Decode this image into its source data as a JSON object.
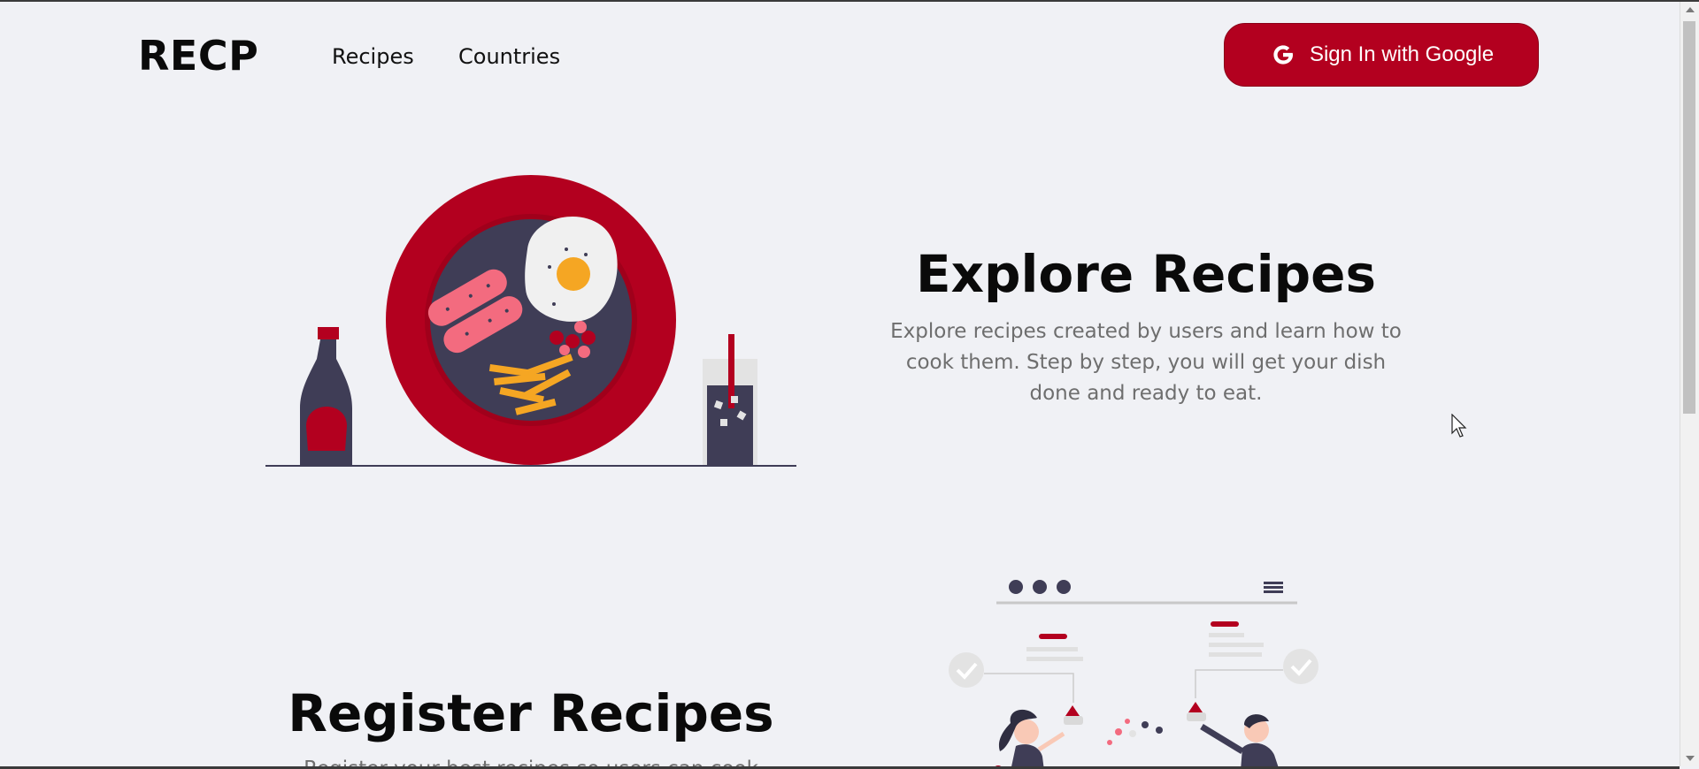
{
  "header": {
    "logo": "RECP",
    "nav": [
      {
        "label": "Recipes"
      },
      {
        "label": "Countries"
      }
    ],
    "signin": {
      "label": "Sign In with Google",
      "icon": "google-icon"
    }
  },
  "hero": {
    "title": "Explore Recipes",
    "description": "Explore recipes created by users and learn how to cook them. Step by step, you will get your dish done and ready to eat.",
    "illustration": "breakfast-plate-illustration"
  },
  "register": {
    "title": "Register Recipes",
    "description": "Register your best recipes so users can cook",
    "illustration": "people-sharing-illustration"
  },
  "colors": {
    "accent": "#b3001f",
    "background": "#f0f1f5",
    "text": "#0a0a0a",
    "muted_text": "#6e6e6e",
    "dark_navy": "#3f3d56"
  }
}
